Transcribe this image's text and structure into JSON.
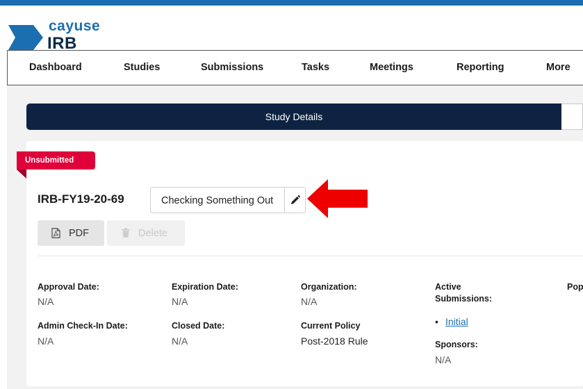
{
  "brand": {
    "name_top": "cayuse",
    "name_bottom": "IRB"
  },
  "nav": {
    "items": [
      "Dashboard",
      "Studies",
      "Submissions",
      "Tasks",
      "Meetings",
      "Reporting",
      "More"
    ]
  },
  "study_bar": {
    "label": "Study Details"
  },
  "study": {
    "status": "Unsubmitted",
    "id": "IRB-FY19-20-69",
    "title": "Checking Something Out"
  },
  "actions": {
    "pdf_label": "PDF",
    "delete_label": "Delete"
  },
  "details": {
    "approval_date": {
      "label": "Approval Date:",
      "value": "N/A"
    },
    "expiration_date": {
      "label": "Expiration Date:",
      "value": "N/A"
    },
    "organization": {
      "label": "Organization:",
      "value": "N/A"
    },
    "active_submissions": {
      "label_line1": "Active",
      "label_line2": "Submissions:",
      "items": [
        "Initial"
      ]
    },
    "population": {
      "label": "Pop"
    },
    "admin_checkin_date": {
      "label": "Admin Check-In Date:",
      "value": "N/A"
    },
    "closed_date": {
      "label": "Closed Date:",
      "value": "N/A"
    },
    "current_policy": {
      "label": "Current Policy",
      "value": "Post-2018 Rule"
    },
    "sponsors": {
      "label": "Sponsors:",
      "value": "N/A"
    }
  },
  "colors": {
    "topbar": "#1a6fb0",
    "navy": "#0d2341",
    "status_red": "#e0003a",
    "arrow_red": "#ee0000",
    "link": "#1a6fb0"
  },
  "icons": {
    "edit": "pencil-icon",
    "pdf": "pdf-file-icon",
    "delete": "trash-icon",
    "logo": "cayuse-logo-icon"
  }
}
